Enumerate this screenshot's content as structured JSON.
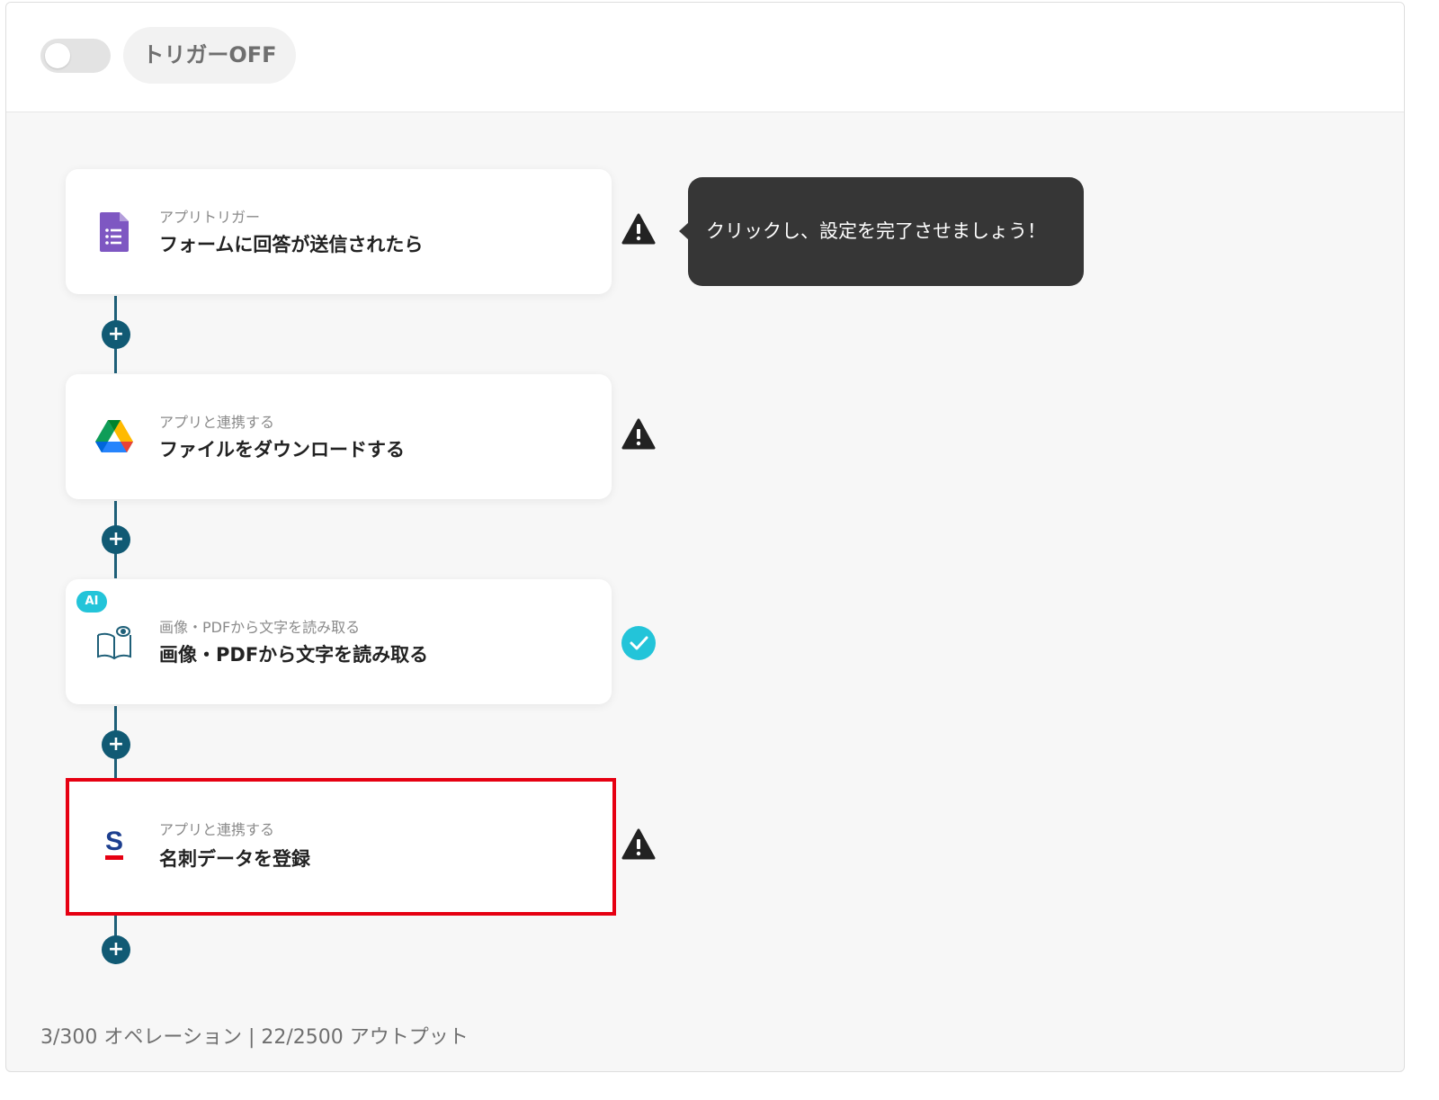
{
  "header": {
    "toggle_state": "off",
    "trigger_label": "トリガーOFF"
  },
  "steps": [
    {
      "sub": "アプリトリガー",
      "title": "フォームに回答が送信されたら",
      "icon": "google-forms-icon",
      "status": "warning"
    },
    {
      "sub": "アプリと連携する",
      "title": "ファイルをダウンロードする",
      "icon": "google-drive-icon",
      "status": "warning"
    },
    {
      "sub": "画像・PDFから文字を読み取る",
      "title": "画像・PDFから文字を読み取る",
      "icon": "ocr-book-icon",
      "badge": "AI",
      "status": "complete"
    },
    {
      "sub": "アプリと連携する",
      "title": "名刺データを登録",
      "icon": "sansan-icon",
      "status": "warning",
      "highlighted": true
    }
  ],
  "tooltip": {
    "text": "クリックし、設定を完了させましょう！"
  },
  "footer": {
    "usage": "3/300 オペレーション | 22/2500 アウトプット"
  },
  "colors": {
    "connector": "#1e5f78",
    "plus_button": "#115a74",
    "highlight_border": "#e60012",
    "check": "#23c4d9",
    "tooltip_bg": "#363636"
  }
}
